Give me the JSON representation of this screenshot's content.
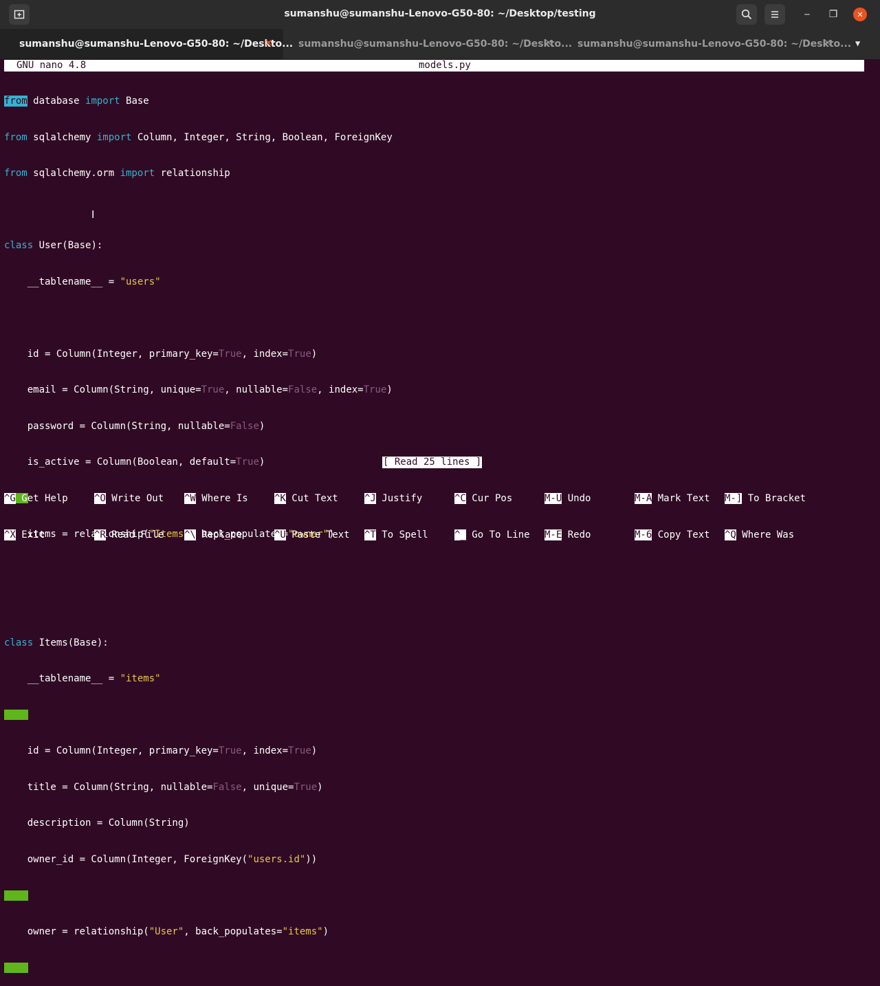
{
  "window": {
    "title": "sumanshu@sumanshu-Lenovo-G50-80: ~/Desktop/testing",
    "new_tab_icon": "new-tab-icon",
    "search_icon": "search-icon",
    "menu_icon": "hamburger-menu-icon",
    "minimize": "‒",
    "maximize": "❐",
    "close": "✕"
  },
  "tabs": [
    {
      "label": "sumanshu@sumanshu-Lenovo-G50-80: ~/Deskto...",
      "close": "✕",
      "active": true
    },
    {
      "label": "sumanshu@sumanshu-Lenovo-G50-80: ~/Deskto...",
      "close": "✕",
      "active": false
    },
    {
      "label": "sumanshu@sumanshu-Lenovo-G50-80: ~/Deskto...",
      "close": "✕",
      "active": false
    }
  ],
  "tab_menu": "▼",
  "nano": {
    "version": "GNU nano 4.8",
    "filename": "models.py",
    "status": "[ Read 25 lines ]"
  },
  "code": {
    "l1": {
      "kw1": "from",
      "t1": " database ",
      "kw2": "import",
      "t2": " Base"
    },
    "l2": {
      "kw1": "from",
      "t1": " sqlalchemy ",
      "kw2": "import",
      "t2": " Column, Integer, String, Boolean, ForeignKey"
    },
    "l3": {
      "kw1": "from",
      "t1": " sqlalchemy.orm ",
      "kw2": "import",
      "t2": " relationship"
    },
    "l5": {
      "kw1": "class",
      "t1": " User(Base):"
    },
    "l6": {
      "t1": "    __tablename__ = ",
      "s1": "\"users\""
    },
    "l8": {
      "t1": "    id = Column(Integer, primary_key=",
      "b1": "True",
      "t2": ", index=",
      "b2": "True",
      "t3": ")"
    },
    "l9": {
      "t1": "    email = Column(String, unique=",
      "b1": "True",
      "t2": ", nullable=",
      "b2": "False",
      "t3": ", index=",
      "b3": "True",
      "t4": ")"
    },
    "l10": {
      "t1": "    password = Column(String, nullable=",
      "b1": "False",
      "t2": ")"
    },
    "l11": {
      "t1": "    is_active = Column(Boolean, default=",
      "b1": "True",
      "t2": ")"
    },
    "l13": {
      "t1": "    items = relationship(",
      "s1": "\"Items\"",
      "t2": ", back_populates=",
      "s2": "\"owner\"",
      "t3": ")"
    },
    "l16": {
      "kw1": "class",
      "t1": " Items(Base):"
    },
    "l17": {
      "t1": "    __tablename__ = ",
      "s1": "\"items\""
    },
    "l19": {
      "t1": "    id = Column(Integer, primary_key=",
      "b1": "True",
      "t2": ", index=",
      "b2": "True",
      "t3": ")"
    },
    "l20": {
      "t1": "    title = Column(String, nullable=",
      "b1": "False",
      "t2": ", unique=",
      "b2": "True",
      "t3": ")"
    },
    "l21": {
      "t1": "    description = Column(String)"
    },
    "l22": {
      "t1": "    owner_id = Column(Integer, ForeignKey(",
      "s1": "\"users.id\"",
      "t2": "))"
    },
    "l24": {
      "t1": "    owner = relationship(",
      "s1": "\"User\"",
      "t2": ", back_populates=",
      "s2": "\"items\"",
      "t3": ")"
    }
  },
  "shortcuts": [
    {
      "k1": "^G",
      "l1": " Get Help",
      "k2": "^X",
      "l2": " Exit"
    },
    {
      "k1": "^O",
      "l1": " Write Out",
      "k2": "^R",
      "l2": " Read File"
    },
    {
      "k1": "^W",
      "l1": " Where Is",
      "k2": "^\\",
      "l2": " Replace"
    },
    {
      "k1": "^K",
      "l1": " Cut Text",
      "k2": "^U",
      "l2": " Paste Text"
    },
    {
      "k1": "^J",
      "l1": " Justify",
      "k2": "^T",
      "l2": " To Spell"
    },
    {
      "k1": "^C",
      "l1": " Cur Pos",
      "k2": "^_",
      "l2": " Go To Line"
    },
    {
      "k1": "M-U",
      "l1": " Undo",
      "k2": "M-E",
      "l2": " Redo"
    },
    {
      "k1": "M-A",
      "l1": " Mark Text",
      "k2": "M-6",
      "l2": " Copy Text"
    },
    {
      "k1": "M-]",
      "l1": " To Bracket",
      "k2": "^Q",
      "l2": " Where Was"
    }
  ],
  "colors": {
    "background": "#300a24",
    "keyword": "#34b3cf",
    "string": "#e4c84a",
    "boolean": "#8a5a80",
    "trailing_whitespace": "#5fb61b",
    "close_accent": "#e95420"
  }
}
